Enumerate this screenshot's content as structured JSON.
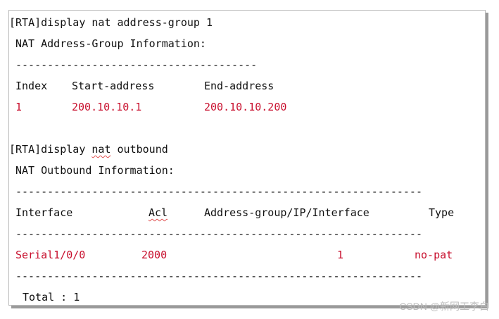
{
  "cmd1": {
    "prompt": "[RTA]",
    "command": "display nat address-group 1",
    "title": "NAT Address-Group Information:",
    "separator": "--------------------------------------",
    "headers": [
      "Index",
      "Start-address",
      "End-address"
    ],
    "row": [
      "1",
      "200.10.10.1",
      "200.10.10.200"
    ]
  },
  "cmd2": {
    "prompt": "[RTA]",
    "command_pre": "display ",
    "command_nat": "nat",
    "command_post": " outbound",
    "title": "NAT Outbound Information:",
    "separator": "----------------------------------------------------------------",
    "headers": [
      "Interface",
      "Acl",
      "Address-group/IP/Interface",
      "Type"
    ],
    "row": [
      "Serial1/0/0",
      "2000",
      "1",
      "no-pat"
    ],
    "total": "Total : 1"
  },
  "watermark": "CSDN @新网工李白",
  "colors": {
    "value_red": "#c8102e",
    "text": "#111111"
  }
}
